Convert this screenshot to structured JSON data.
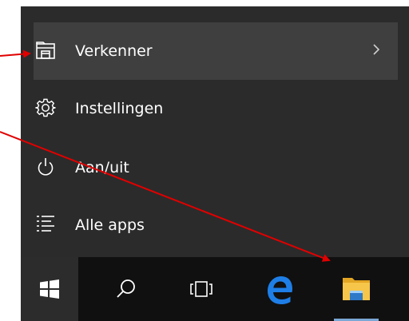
{
  "start_menu": {
    "items": [
      {
        "label": "Verkenner",
        "icon": "file-explorer-icon",
        "has_submenu": true
      },
      {
        "label": "Instellingen",
        "icon": "gear-icon"
      },
      {
        "label": "Aan/uit",
        "icon": "power-icon"
      },
      {
        "label": "Alle apps",
        "icon": "list-icon"
      }
    ]
  },
  "taskbar": {
    "buttons": [
      {
        "icon": "windows-logo-icon"
      },
      {
        "icon": "search-icon"
      },
      {
        "icon": "task-view-icon"
      },
      {
        "icon": "edge-icon"
      },
      {
        "icon": "file-explorer-icon"
      }
    ]
  },
  "colors": {
    "menu_bg": "#2b2b2b",
    "highlight_bg": "#3f3f3f",
    "taskbar_bg": "#101010",
    "annotation_arrow": "#e00000",
    "edge_blue": "#1e7ee6",
    "folder_yellow": "#f6c64a"
  }
}
